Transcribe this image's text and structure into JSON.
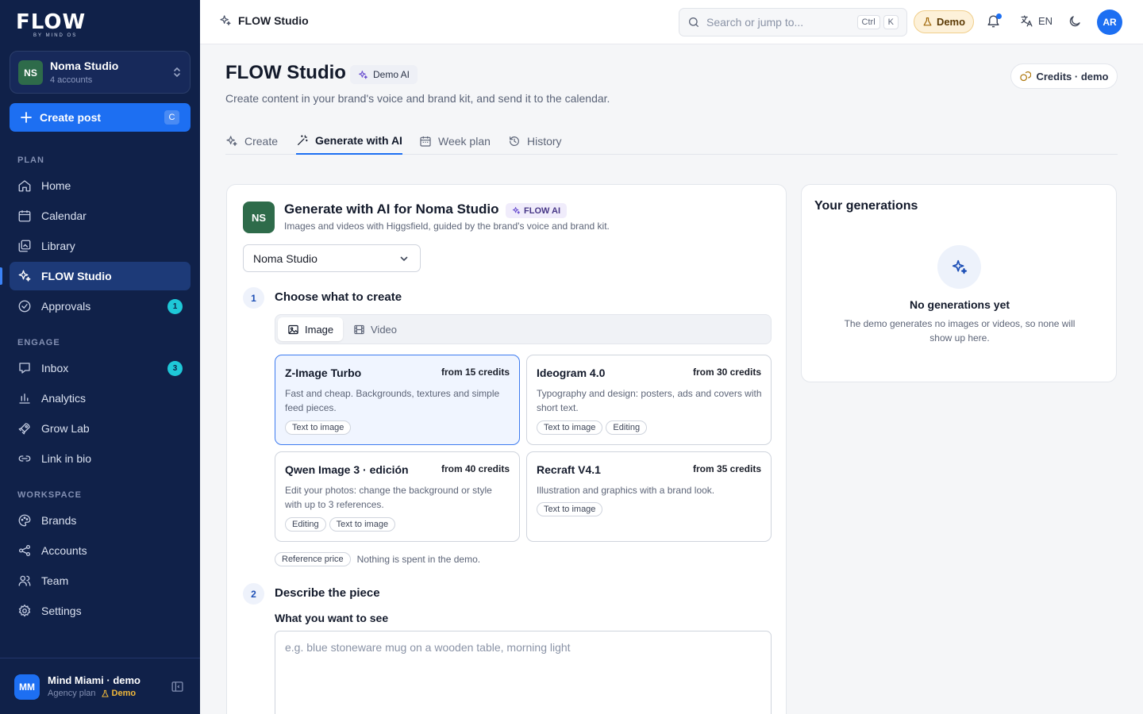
{
  "sidebar": {
    "logo": "FLOW",
    "logo_sub": "BY MIND OS",
    "workspace": {
      "initials": "NS",
      "name": "Noma Studio",
      "sub": "4 accounts"
    },
    "create_post": {
      "label": "Create post",
      "shortcut": "C"
    },
    "sections": {
      "plan": "PLAN",
      "engage": "ENGAGE",
      "workspace": "WORKSPACE"
    },
    "plan_items": [
      {
        "label": "Home",
        "icon": "home-icon"
      },
      {
        "label": "Calendar",
        "icon": "calendar-icon"
      },
      {
        "label": "Library",
        "icon": "library-icon"
      },
      {
        "label": "FLOW Studio",
        "icon": "sparkles-icon",
        "active": true
      },
      {
        "label": "Approvals",
        "icon": "check-circle-icon",
        "badge": "1"
      }
    ],
    "engage_items": [
      {
        "label": "Inbox",
        "icon": "inbox-icon",
        "badge": "3"
      },
      {
        "label": "Analytics",
        "icon": "bar-chart-icon"
      },
      {
        "label": "Grow Lab",
        "icon": "rocket-icon"
      },
      {
        "label": "Link in bio",
        "icon": "link-icon"
      }
    ],
    "workspace_items": [
      {
        "label": "Brands",
        "icon": "palette-icon"
      },
      {
        "label": "Accounts",
        "icon": "share-icon"
      },
      {
        "label": "Team",
        "icon": "users-icon"
      },
      {
        "label": "Settings",
        "icon": "gear-icon"
      }
    ],
    "footer": {
      "initials": "MM",
      "name": "Mind Miami · demo",
      "plan": "Agency plan",
      "demo": "Demo"
    }
  },
  "topbar": {
    "title": "FLOW Studio",
    "search_placeholder": "Search or jump to...",
    "kbd_ctrl": "Ctrl",
    "kbd_k": "K",
    "demo_label": "Demo",
    "lang": "EN",
    "user_initials": "AR"
  },
  "page": {
    "title": "FLOW Studio",
    "badge": "Demo AI",
    "subtitle": "Create content in your brand's voice and brand kit, and send it to the calendar.",
    "credits_button": "Credits · demo",
    "tabs": [
      {
        "label": "Create",
        "icon": "sparkles-icon"
      },
      {
        "label": "Generate with AI",
        "icon": "wand-icon",
        "active": true
      },
      {
        "label": "Week plan",
        "icon": "calendar-icon"
      },
      {
        "label": "History",
        "icon": "history-icon"
      }
    ]
  },
  "generator": {
    "avatar": "NS",
    "title": "Generate with AI for Noma Studio",
    "badge": "FLOW AI",
    "subtitle": "Images and videos with Higgsfield, guided by the brand's voice and brand kit.",
    "brand_select": "Noma Studio",
    "step1": {
      "num": "1",
      "title": "Choose what to create"
    },
    "media_types": [
      {
        "label": "Image",
        "icon": "image-icon",
        "active": true
      },
      {
        "label": "Video",
        "icon": "film-icon"
      }
    ],
    "models": [
      {
        "name": "Z-Image Turbo",
        "price": "from 15 credits",
        "desc": "Fast and cheap. Backgrounds, textures and simple feed pieces.",
        "tags": [
          "Text to image"
        ],
        "selected": true
      },
      {
        "name": "Ideogram 4.0",
        "price": "from 30 credits",
        "desc": "Typography and design: posters, ads and covers with short text.",
        "tags": [
          "Text to image",
          "Editing"
        ]
      },
      {
        "name": "Qwen Image 3 · edición",
        "price": "from 40 credits",
        "desc": "Edit your photos: change the background or style with up to 3 references.",
        "tags": [
          "Editing",
          "Text to image"
        ]
      },
      {
        "name": "Recraft V4.1",
        "price": "from 35 credits",
        "desc": "Illustration and graphics with a brand look.",
        "tags": [
          "Text to image"
        ]
      }
    ],
    "reference_tag": "Reference price",
    "reference_note": "Nothing is spent in the demo.",
    "step2": {
      "num": "2",
      "title": "Describe the piece"
    },
    "prompt_label": "What you want to see",
    "prompt_placeholder": "e.g. blue stoneware mug on a wooden table, morning light"
  },
  "generations": {
    "title": "Your generations",
    "empty_title": "No generations yet",
    "empty_desc": "The demo generates no images or videos, so none will show up here."
  }
}
